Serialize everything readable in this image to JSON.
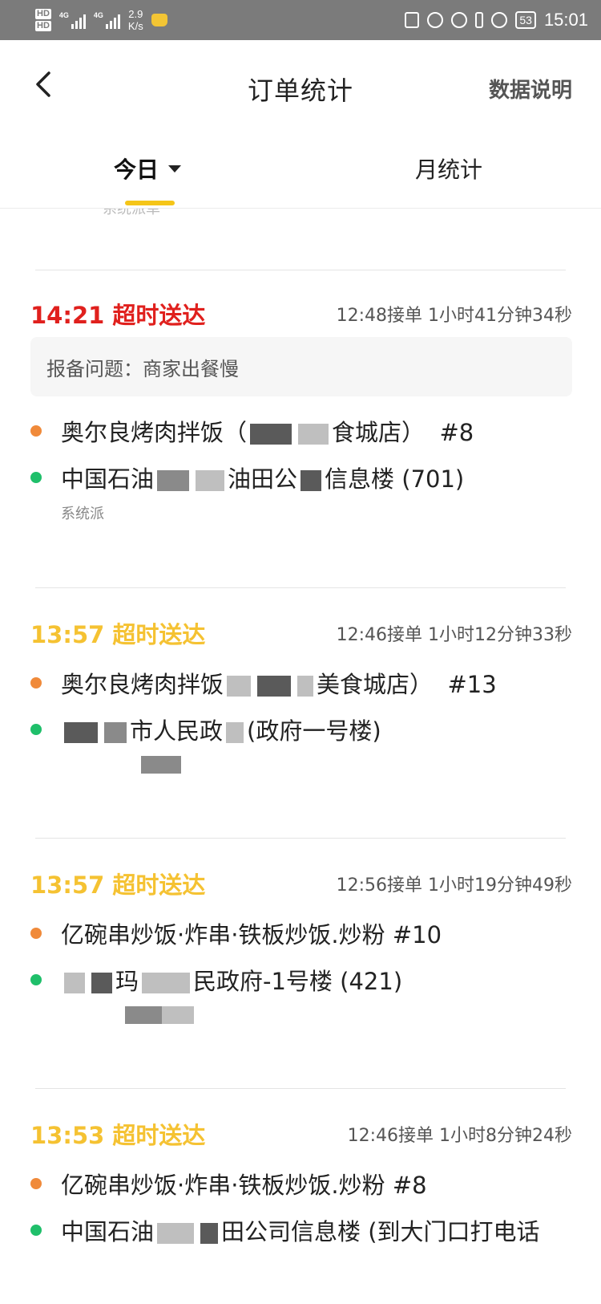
{
  "status_bar": {
    "hd1": "HD",
    "hd2": "HD",
    "sig1": "4G",
    "sig2": "4G",
    "speed_value": "2.9",
    "speed_unit": "K/s",
    "battery": "53",
    "time": "15:01"
  },
  "header": {
    "title": "订单统计",
    "data_explain": "数据说明"
  },
  "tabs": {
    "today": "今日",
    "month": "月统计"
  },
  "list": {
    "clipped_note": "系统派单",
    "orders": [
      {
        "arrive_time": "14:21",
        "status": "超时送达",
        "status_color": "#e0201d",
        "take_info": "12:48接单 1小时41分钟34秒",
        "issue": "报备问题：商家出餐慢",
        "shop_a": "奥尔良烤肉拌饭（",
        "shop_b": "食城店）",
        "shop_no": "#8",
        "addr_a": "中国石油",
        "addr_b": "油田公",
        "addr_c": "信息楼 (701)",
        "note": "系统派"
      },
      {
        "arrive_time": "13:57",
        "status": "超时送达",
        "status_color": "#f5c232",
        "take_info": "12:46接单 1小时12分钟33秒",
        "shop_a": "奥尔良烤肉拌饭",
        "shop_b": "美食城店）",
        "shop_no": "#13",
        "addr_a": "市人民政",
        "addr_b": "(政府一号楼)"
      },
      {
        "arrive_time": "13:57",
        "status": "超时送达",
        "status_color": "#f5c232",
        "take_info": "12:56接单 1小时19分钟49秒",
        "shop_a": "亿碗串炒饭·炸串·铁板炒饭.炒粉",
        "shop_no": "#10",
        "addr_a": "玛",
        "addr_b": "民政府-1号楼 (421)"
      },
      {
        "arrive_time": "13:53",
        "status": "超时送达",
        "status_color": "#f5c232",
        "take_info": "12:46接单 1小时8分钟24秒",
        "shop_a": "亿碗串炒饭·炸串·铁板炒饭.炒粉",
        "shop_no": "#8",
        "addr_a": "中国石油",
        "addr_b": "田公司信息楼 (到大门口打电话"
      }
    ]
  }
}
